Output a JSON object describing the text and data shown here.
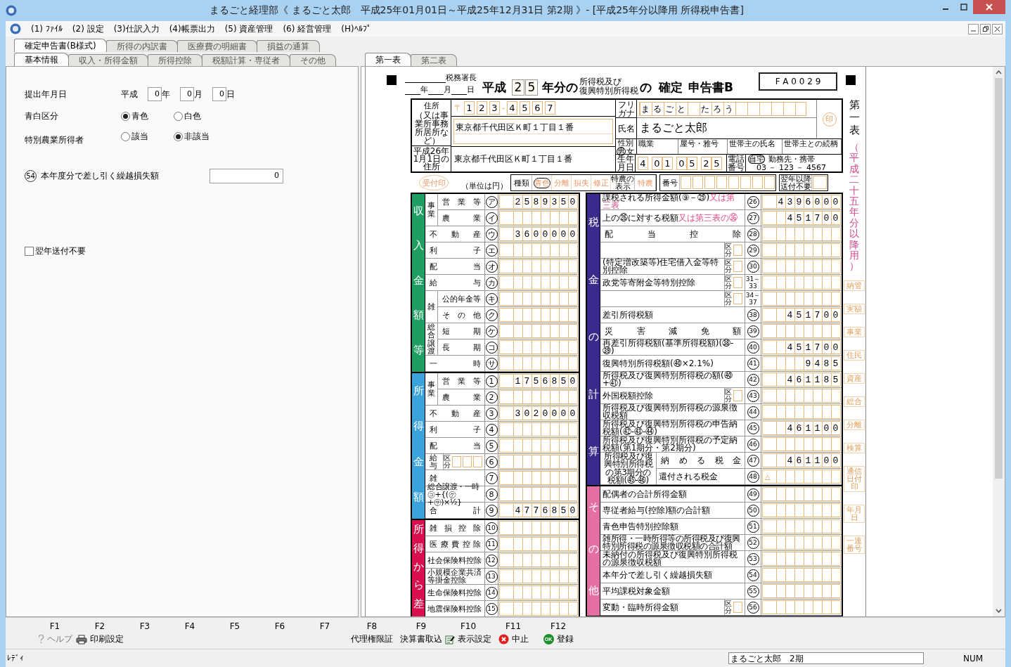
{
  "window": {
    "title": "まるごと経理部《 まるごと太郎　平成25年01月01日～平成25年12月31日 第2期 》- [平成25年分以降用 所得税申告書]"
  },
  "menu": [
    "(1) ﾌｧｲﾙ",
    "(2) 設定",
    "(3)仕訳入力",
    "(4)帳票出力",
    "(5) 資産管理",
    "(6) 経営管理",
    "(H)ﾍﾙﾌﾟ"
  ],
  "doc_tabs": [
    {
      "label": "確定申告書(B様式)",
      "selected": true
    },
    {
      "label": "所得の内訳書",
      "selected": false
    },
    {
      "label": "医療費の明細書",
      "selected": false
    },
    {
      "label": "損益の通算",
      "selected": false
    }
  ],
  "input_tabs": [
    {
      "label": "基本情報",
      "selected": true
    },
    {
      "label": "収入・所得金額",
      "selected": false
    },
    {
      "label": "所得控除",
      "selected": false
    },
    {
      "label": "税額計算・専従者",
      "selected": false
    },
    {
      "label": "その他",
      "selected": false
    }
  ],
  "sheet_tabs": [
    {
      "label": "第一表",
      "selected": true
    },
    {
      "label": "第二表",
      "selected": false
    }
  ],
  "basic_info": {
    "submit_date": {
      "label": "提出年月日",
      "era": "平成",
      "parts": [
        {
          "value": "0",
          "unit": "年"
        },
        {
          "value": "0",
          "unit": "月"
        },
        {
          "value": "0",
          "unit": "日"
        }
      ]
    },
    "radio_groups": [
      {
        "label": "青白区分",
        "options": [
          {
            "label": "青色",
            "selected": true
          },
          {
            "label": "白色",
            "selected": false
          }
        ]
      },
      {
        "label": "特別農業所得者",
        "options": [
          {
            "label": "該当",
            "selected": false
          },
          {
            "label": "非該当",
            "selected": true
          }
        ]
      }
    ],
    "carryover": {
      "number": "54",
      "label": "本年度分で差し引く繰越損失額",
      "value": "0"
    },
    "no_send": {
      "label": "翌年送付不要",
      "checked": false
    }
  },
  "form": {
    "header": {
      "office_suffix": "税務署長",
      "date_units": [
        "年",
        "月",
        "日"
      ],
      "era": "平成",
      "year_digits": [
        "2",
        "5"
      ],
      "year_suffix": "年分の",
      "tax_names": [
        "所得税及び",
        "復興特別所得税"
      ],
      "connector": "の",
      "title_a": "確定",
      "title_b": "申告書B",
      "code": "F A 0 0 2 9"
    },
    "side_title": "第一表",
    "side_note": "（平成二十五年分以降用）",
    "office_labels": [
      "納管",
      "実額",
      "事業",
      "住民",
      "資産",
      "総合",
      "分離",
      "検算",
      "通信日付印",
      "年月日",
      "一連番号"
    ],
    "address": {
      "label": "住所",
      "label_note": "（又は事業所事務所居所など）",
      "postal_mark": "〒",
      "postal": [
        "1",
        "2",
        "3",
        "4",
        "5",
        "6",
        "7"
      ],
      "postal_sep": "-",
      "value": "東京都千代田区Ｋ町１丁目１番",
      "jan1_label": "平成26年1月1日の住所",
      "jan1_value": "東京都千代田区Ｋ町１丁目１番"
    },
    "name": {
      "furigana_label": "フリガナ",
      "furigana": "まるごと　たろう",
      "name_label": "氏名",
      "name": "まるごと太郎",
      "seal": "印"
    },
    "profile": {
      "sex_label": "性別",
      "sex": [
        {
          "label": "男",
          "selected": true
        },
        {
          "label": "女",
          "selected": false
        }
      ],
      "fields": [
        "職業",
        "屋号・雅号",
        "世帯主の氏名",
        "世帯主との続柄"
      ],
      "birth_label": "生年月日",
      "birth_era": "4",
      "birth": [
        "0",
        "1",
        "0",
        "5",
        "2",
        "5"
      ],
      "phone_label": "電話番号",
      "phone_kinds": [
        {
          "label": "自宅",
          "selected": true
        },
        {
          "label": "勤務先・携帯",
          "selected": false
        }
      ],
      "phone": "03 － 123 － 4567"
    },
    "type_row": {
      "stamp": "受付印",
      "unit_note": "（単位は円）",
      "label": "種類",
      "kinds": [
        {
          "label": "青色",
          "selected": true
        },
        {
          "label": "分離",
          "selected": false
        },
        {
          "label": "損失",
          "selected": false
        },
        {
          "label": "修正",
          "selected": false
        }
      ],
      "special_label": "特農の表示",
      "special": "特農",
      "number_label": "番号",
      "no_send_label": "翌年以降送付不要"
    },
    "left_table": [
      {
        "title": "収入金額等",
        "color": "#1e9e62",
        "rows": [
          {
            "group": "事業",
            "rows": [
              {
                "label": "営業等",
                "mark": "ア",
                "value": "2 5 8 9 3 5 0"
              },
              {
                "label": "農業",
                "mark": "イ"
              }
            ]
          },
          {
            "label": "不動産",
            "mark": "ウ",
            "value": "3 6 0 0 0 0 0"
          },
          {
            "label": "利子",
            "mark": "エ"
          },
          {
            "label": "配当",
            "mark": "オ"
          },
          {
            "label": "給与",
            "mark": "カ"
          },
          {
            "group": "雑",
            "rows": [
              {
                "label": "公的年金等",
                "mark": "キ"
              },
              {
                "label": "その他",
                "mark": "ク"
              }
            ]
          },
          {
            "group": "総合譲渡",
            "rows": [
              {
                "label": "短期",
                "mark": "ケ"
              },
              {
                "label": "長期",
                "mark": "コ"
              }
            ]
          },
          {
            "label": "一時",
            "mark": "サ"
          }
        ]
      },
      {
        "title": "所得金額",
        "color": "#3ba3dc",
        "rows": [
          {
            "group": "事業",
            "rows": [
              {
                "label": "営業等",
                "mark": "1",
                "value": "1 7 5 6 8 5 0"
              },
              {
                "label": "農業",
                "mark": "2"
              }
            ]
          },
          {
            "label": "不動産",
            "mark": "3",
            "value": "3 0 2 0 0 0 0"
          },
          {
            "label": "利子",
            "mark": "4"
          },
          {
            "label": "配当",
            "mark": "5"
          },
          {
            "label": "給与",
            "mark": "6",
            "kubun": "区分"
          },
          {
            "label": "雑",
            "mark": "7"
          },
          {
            "label": "総合譲渡・一時",
            "note": "㋙+{(㋘+㋚)×½}",
            "mark": "8"
          },
          {
            "label": "合計",
            "mark": "9",
            "value": "4 7 7 6 8 5 0"
          }
        ]
      },
      {
        "title": "所得から差",
        "color": "#d8104f",
        "rows": [
          {
            "label": "雑損控除",
            "mark": "10"
          },
          {
            "label": "医療費控除",
            "mark": "11"
          },
          {
            "label": "社会保険料控除",
            "mark": "12"
          },
          {
            "label": "小規模企業共済等掛金控除",
            "mark": "13"
          },
          {
            "label": "生命保険料控除",
            "mark": "14"
          },
          {
            "label": "地震保険料控除",
            "mark": "15"
          }
        ]
      }
    ],
    "right_table": [
      {
        "title": "税金の計算",
        "color": "#3a2a8c",
        "rows": [
          {
            "label": "課税される所得金額",
            "note": "(⑨－㉕)",
            "alt_note": "又は第三表",
            "mark": "26",
            "value": "4 3 9 6 0 0 0"
          },
          {
            "label": "上の㉖に対する税額",
            "alt_note": "又は第三表の㊱",
            "mark": "27",
            "value": "4 5 1 7 0 0"
          },
          {
            "label": "配当控除",
            "mark": "28"
          },
          {
            "label": "",
            "kubun": "区分",
            "mark": "29"
          },
          {
            "label": "(特定増改築等)住宅借入金等特別控除",
            "kubun": "区分",
            "mark": "30"
          },
          {
            "label": "政党等寄附金等特別控除",
            "kubun": "区分",
            "mark": "31～33"
          },
          {
            "label": "",
            "kubun": "区分",
            "mark": "34～37"
          },
          {
            "label": "差引所得税額",
            "mark": "38",
            "value": "4 5 1 7 0 0"
          },
          {
            "label": "災害減免額",
            "mark": "39"
          },
          {
            "label": "再差引所得税額(基準所得税額)",
            "note": "(㊳-㊴)",
            "mark": "40",
            "value": "4 5 1 7 0 0"
          },
          {
            "label": "復興特別所得税額",
            "note": "(㊵×2.1%)",
            "mark": "41",
            "value": "9 4 8 5"
          },
          {
            "label": "所得税及び復興特別所得税の額",
            "note": "(㊵+㊶)",
            "mark": "42",
            "value": "4 6 1 1 8 5"
          },
          {
            "label": "外国税額控除",
            "kubun": "区分",
            "mark": "43"
          },
          {
            "label": "所得税及び復興特別所得税の源泉徴収税額",
            "mark": "44"
          },
          {
            "label": "所得税及び復興特別所得税の申告納税額",
            "note": "(㊷-㊸-㊹)",
            "mark": "45",
            "value": "4 6 1 1 0 0"
          },
          {
            "label": "所得税及び復興特別所得税の予定納税額",
            "note": "(第1期分・第2期分)",
            "mark": "46"
          },
          {
            "group": "所得税及び復興特別所得税の第3期分の税額(㊺-㊻)",
            "rows": [
              {
                "label": "納める税金",
                "mark": "47",
                "value": "4 6 1 1 0 0"
              },
              {
                "label": "還付される税金",
                "mark": "48",
                "prefix": "△"
              }
            ]
          }
        ]
      },
      {
        "title": "その他",
        "color": "#e56fa3",
        "rows": [
          {
            "label": "配偶者の合計所得金額",
            "mark": "49"
          },
          {
            "label": "専従者給与(控除)額の合計額",
            "mark": "50"
          },
          {
            "label": "青色申告特別控除額",
            "mark": "51"
          },
          {
            "label": "雑所得・一時所得等の所得税及び復興特別所得税の源泉徴収税額の合計額",
            "mark": "52"
          },
          {
            "label": "未納付の所得税及び復興特別所得税の源泉徴収税額",
            "mark": "53"
          },
          {
            "label": "本年分で差し引く繰越損失額",
            "mark": "54"
          },
          {
            "label": "平均課税対象金額",
            "mark": "55"
          },
          {
            "label": "変動・臨時所得金額",
            "kubun": "区分",
            "mark": "56"
          }
        ]
      }
    ]
  },
  "function_keys": [
    {
      "key": "F1",
      "label": "ヘルプ",
      "disabled": true
    },
    {
      "key": "F2",
      "label": "印刷設定",
      "disabled": false
    },
    {
      "key": "F3"
    },
    {
      "key": "F4"
    },
    {
      "key": "F5"
    },
    {
      "key": "F6"
    },
    {
      "key": "F7"
    },
    {
      "key": "F8",
      "label": "代理権限証",
      "disabled": false
    },
    {
      "key": "F9",
      "label": "決算書取込",
      "disabled": false
    },
    {
      "key": "F10",
      "label": "表示設定",
      "disabled": false
    },
    {
      "key": "F11",
      "label": "中止",
      "disabled": false
    },
    {
      "key": "F12",
      "label": "登録",
      "badge": "OK",
      "disabled": false
    }
  ],
  "status_bar": {
    "message": "ﾚﾃﾞｨ",
    "company": "まるごと太郎　2期",
    "mode": "NUM"
  }
}
